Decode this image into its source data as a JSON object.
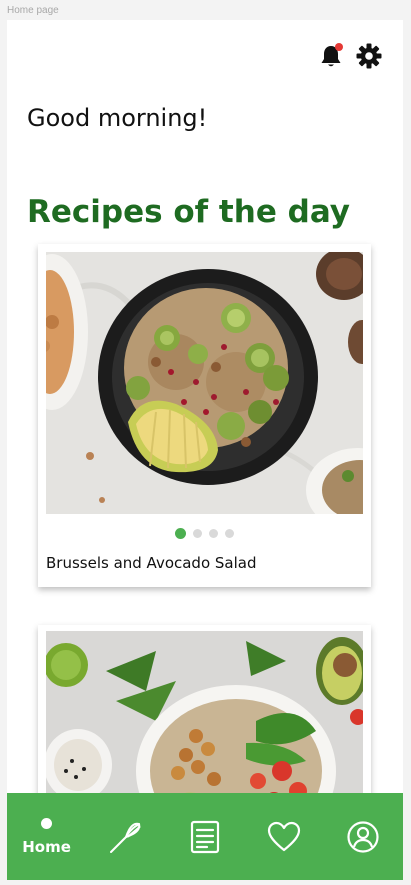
{
  "frame_label": "Home page",
  "header": {
    "icons": [
      "notification-bell-icon",
      "settings-gear-icon"
    ],
    "notification_dot_color": "#e53935"
  },
  "greeting": "Good morning!",
  "section_title": "Recipes of the day",
  "recipes": [
    {
      "title": "Brussels and Avocado Salad",
      "image": "brussels-avocado-quinoa-bowl",
      "pager": {
        "total": 4,
        "active": 1
      }
    },
    {
      "title": "",
      "image": "chickpea-quinoa-spinach-bowl"
    }
  ],
  "bottom_nav": {
    "items": [
      {
        "label": "Home",
        "icon": "home-dot-icon",
        "active": true
      },
      {
        "label": "",
        "icon": "whisk-icon"
      },
      {
        "label": "",
        "icon": "list-document-icon"
      },
      {
        "label": "",
        "icon": "heart-icon"
      },
      {
        "label": "",
        "icon": "user-profile-icon"
      }
    ]
  },
  "colors": {
    "accent_green": "#4caf50",
    "title_green": "#1e6b21",
    "background": "#ffffff",
    "canvas": "#f3f3f3"
  }
}
